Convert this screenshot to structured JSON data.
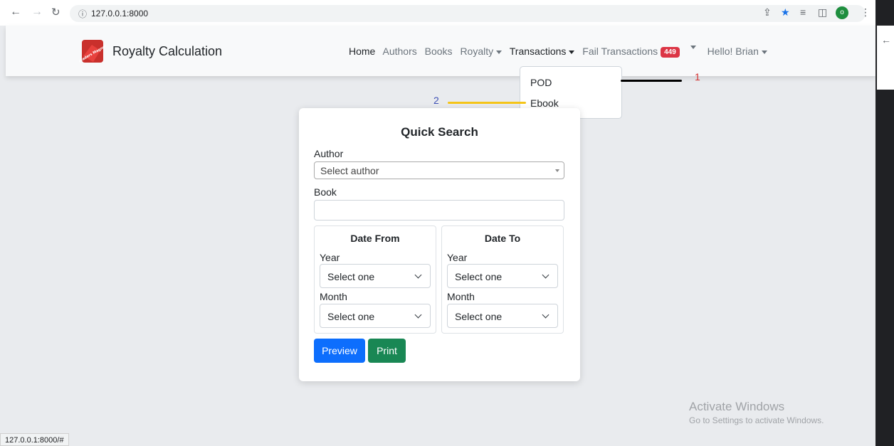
{
  "browser": {
    "url": "127.0.0.1:8000",
    "status_url": "127.0.0.1:8000/#",
    "profile_initial": "o"
  },
  "navbar": {
    "brand": "Royalty Calculation",
    "logo_text": "Readers Magnet",
    "links": {
      "home": "Home",
      "authors": "Authors",
      "books": "Books",
      "royalty": "Royalty",
      "transactions": "Transactions",
      "fail_transactions": "Fail Transactions",
      "fail_count": "449",
      "user": "Hello! Brian"
    }
  },
  "dropdown": {
    "items": [
      "POD",
      "Ebook"
    ]
  },
  "annotations": {
    "one": "1",
    "two": "2",
    "line_black": "#000000",
    "line_yellow": "#f5c518"
  },
  "search": {
    "title": "Quick Search",
    "author_label": "Author",
    "author_placeholder": "Select author",
    "book_label": "Book",
    "book_value": "",
    "date_from": {
      "title": "Date From",
      "year_label": "Year",
      "year_value": "Select one",
      "month_label": "Month",
      "month_value": "Select one"
    },
    "date_to": {
      "title": "Date To",
      "year_label": "Year",
      "year_value": "Select one",
      "month_label": "Month",
      "month_value": "Select one"
    },
    "preview_label": "Preview",
    "print_label": "Print"
  },
  "colors": {
    "primary": "#0d6efd",
    "success": "#198754",
    "badge": "#dc3545"
  },
  "watermark": {
    "line1": "Activate Windows",
    "line2": "Go to Settings to activate Windows."
  }
}
